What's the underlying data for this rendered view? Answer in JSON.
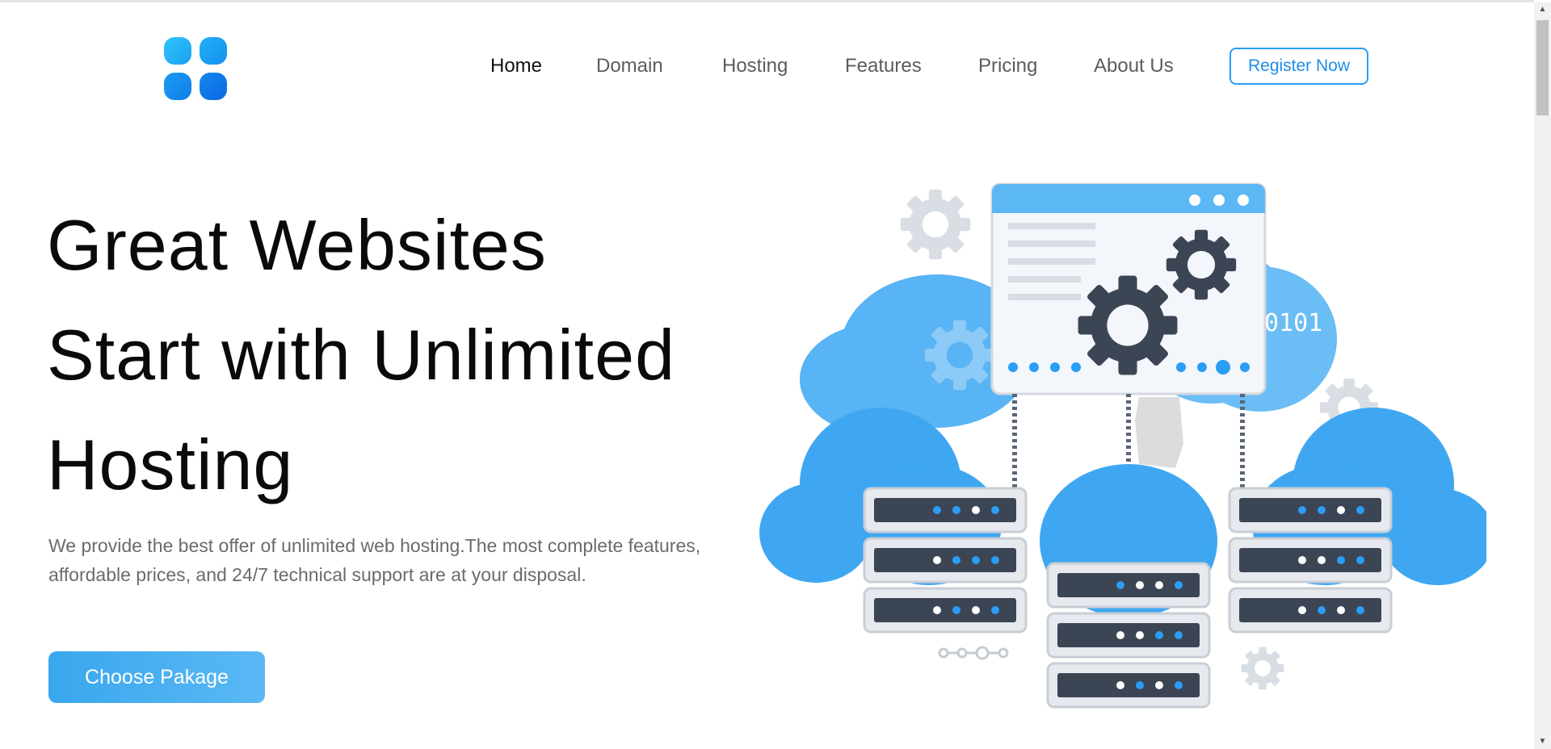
{
  "nav": {
    "items": [
      {
        "label": "Home",
        "active": true
      },
      {
        "label": "Domain",
        "active": false
      },
      {
        "label": "Hosting",
        "active": false
      },
      {
        "label": "Features",
        "active": false
      },
      {
        "label": "Pricing",
        "active": false
      },
      {
        "label": "About Us",
        "active": false
      }
    ],
    "register_label": "Register Now"
  },
  "hero": {
    "title_lines": [
      "Great Websites",
      "Start with Unlimited",
      "Hosting"
    ],
    "description": "We provide the best offer of unlimited web hosting.The most complete features, affordable prices, and 24/7 technical support are at your disposal.",
    "cta_label": "Choose Pakage"
  },
  "illustration": {
    "binary_text": "0101"
  },
  "colors": {
    "accent": "#2a9df4",
    "button_bg": "#4aaef0",
    "cloud": "#3fa7f2",
    "cloud_light": "#8ccaf7",
    "server_dark": "#3c4554",
    "server_frame": "#dde1e6"
  },
  "icons": {
    "logo": "four-rounded-squares-logo",
    "illustration": "cloud-server-hosting-illustration"
  }
}
